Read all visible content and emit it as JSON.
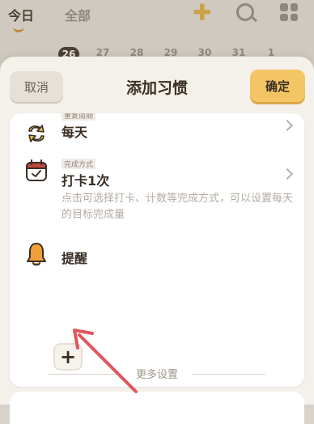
{
  "background": {
    "tabs": [
      "今日",
      "全部"
    ],
    "dates": [
      "26",
      "27",
      "28",
      "29",
      "30",
      "31",
      "1"
    ],
    "active_date": "26"
  },
  "sheet": {
    "cancel_label": "取消",
    "title": "添加习惯",
    "confirm_label": "确定"
  },
  "rows": {
    "frequency": {
      "small_label": "重复周期",
      "value": "每天"
    },
    "completion": {
      "small_label": "完成方式",
      "value": "打卡1次",
      "description": "点击可选择打卡、计数等完成方式，可以设置每天的目标完成量"
    },
    "reminder": {
      "label": "提醒"
    }
  },
  "add_button": "+",
  "more_settings": "更多设置",
  "colors": {
    "accent": "#f4c565",
    "arrow": "#e0575b",
    "calendar_icon": "#c0473d",
    "bell_icon": "#f0a03a",
    "loop_icon": "#f3c04a"
  },
  "icons": [
    "plus-icon",
    "search-icon",
    "grid-icon",
    "loop-icon",
    "calendar-check-icon",
    "bell-icon",
    "chevron-right-icon"
  ]
}
